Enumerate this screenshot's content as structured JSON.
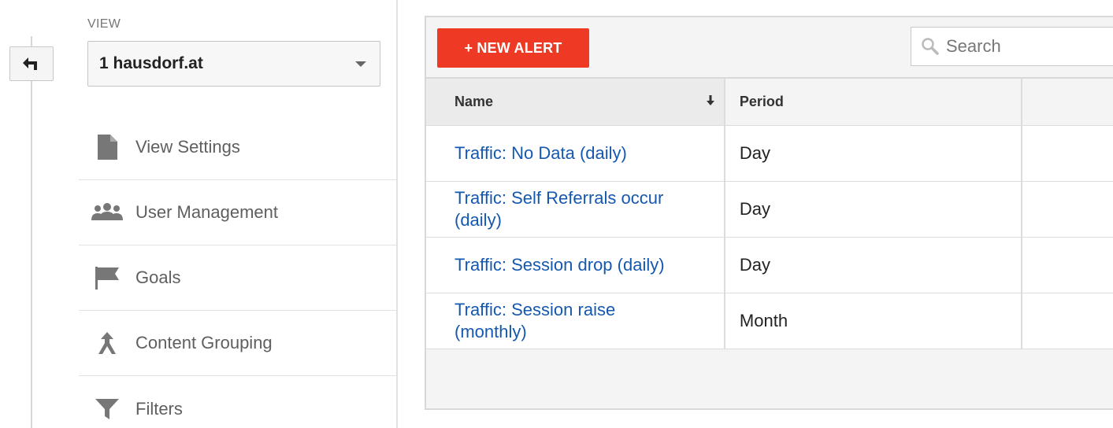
{
  "view_section": {
    "label": "VIEW",
    "selected_view": "1 hausdorf.at"
  },
  "menu": [
    {
      "label": "View Settings",
      "icon": "document-icon"
    },
    {
      "label": "User Management",
      "icon": "users-icon"
    },
    {
      "label": "Goals",
      "icon": "flag-icon"
    },
    {
      "label": "Content Grouping",
      "icon": "content-grouping-icon"
    },
    {
      "label": "Filters",
      "icon": "filter-icon"
    }
  ],
  "toolbar": {
    "new_alert_label": "+ NEW ALERT",
    "search_placeholder": "Search"
  },
  "table": {
    "columns": [
      "Name",
      "Period"
    ],
    "rows": [
      {
        "name": "Traffic: No Data (daily)",
        "period": "Day"
      },
      {
        "name": "Traffic: Self Referrals occur (daily)",
        "period": "Day"
      },
      {
        "name": "Traffic: Session drop (daily)",
        "period": "Day"
      },
      {
        "name": "Traffic: Session raise (monthly)",
        "period": "Month"
      }
    ]
  },
  "colors": {
    "accent_button": "#ee3a24",
    "link": "#1558b0"
  }
}
